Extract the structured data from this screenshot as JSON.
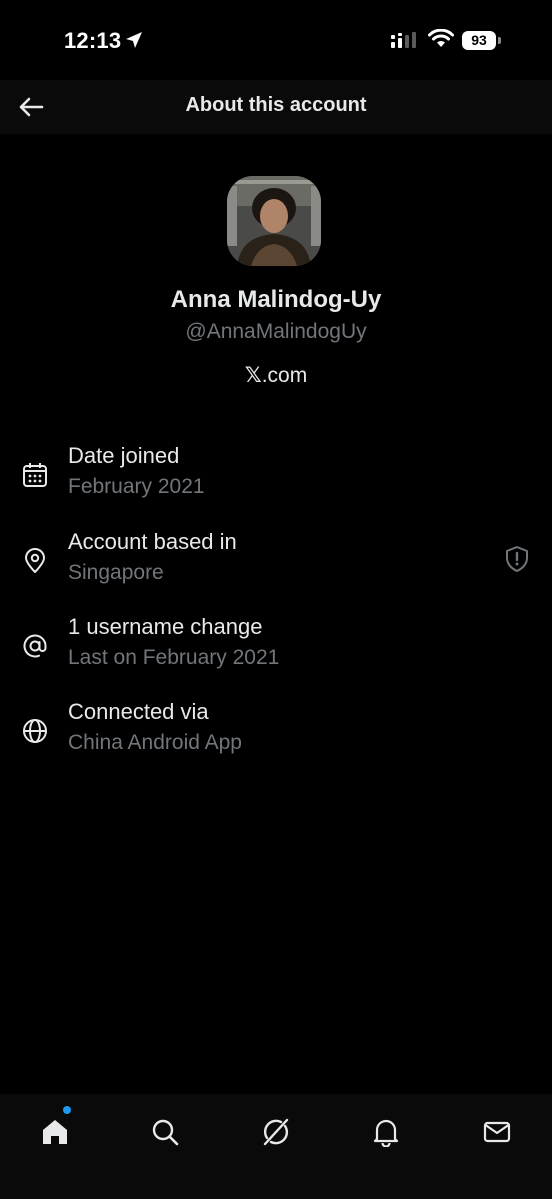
{
  "status_bar": {
    "time": "12:13",
    "battery": "93",
    "icons": [
      "location-arrow-icon",
      "signal-icon",
      "wifi-icon",
      "battery-icon"
    ]
  },
  "header": {
    "title": "About this account",
    "back_icon": "back-arrow-icon"
  },
  "profile": {
    "name": "Anna Malindog-Uy",
    "handle": "@AnnaMalindogUy",
    "site_prefix": "𝕏",
    "site_suffix": ".com"
  },
  "details": [
    {
      "icon": "calendar-icon",
      "title": "Date joined",
      "subtitle": "February 2021"
    },
    {
      "icon": "location-pin-icon",
      "title": "Account based in",
      "subtitle": "Singapore",
      "extra_icon": "shield-alert-icon"
    },
    {
      "icon": "at-sign-icon",
      "title": "1 username change",
      "subtitle": "Last on February 2021"
    },
    {
      "icon": "globe-icon",
      "title": "Connected via",
      "subtitle": "China Android App"
    }
  ],
  "bottom_nav": {
    "items": [
      "home-icon",
      "search-icon",
      "grok-icon",
      "notifications-icon",
      "messages-icon"
    ],
    "home_has_badge": true
  },
  "colors": {
    "background": "#000000",
    "primary_text": "#e7e9ea",
    "secondary_text": "#71767b",
    "accent": "#1d9bf0"
  }
}
